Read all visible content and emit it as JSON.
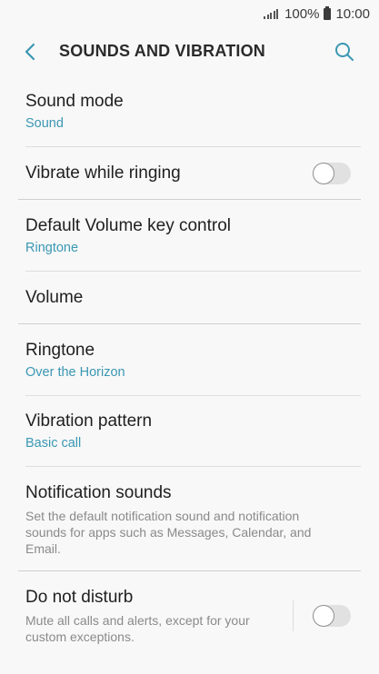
{
  "statusbar": {
    "battery": "100%",
    "time": "10:00"
  },
  "appbar": {
    "title": "SOUNDS AND VIBRATION",
    "back_icon": "back-chevron-icon",
    "search_icon": "search-icon"
  },
  "settings": {
    "sound_mode": {
      "title": "Sound mode",
      "value": "Sound"
    },
    "vibrate_while_ringing": {
      "title": "Vibrate while ringing",
      "enabled": false
    },
    "default_volume_key": {
      "title": "Default Volume key control",
      "value": "Ringtone"
    },
    "volume": {
      "title": "Volume"
    },
    "ringtone": {
      "title": "Ringtone",
      "value": "Over the Horizon"
    },
    "vibration_pattern": {
      "title": "Vibration pattern",
      "value": "Basic call"
    },
    "notification_sounds": {
      "title": "Notification sounds",
      "description": "Set the default notification sound and notification sounds for apps such as Messages, Calendar, and Email."
    },
    "do_not_disturb": {
      "title": "Do not disturb",
      "description": "Mute all calls and alerts, except for your custom exceptions.",
      "enabled": false
    }
  },
  "colors": {
    "accent": "#3a97b3",
    "background": "#f8f8f8"
  }
}
